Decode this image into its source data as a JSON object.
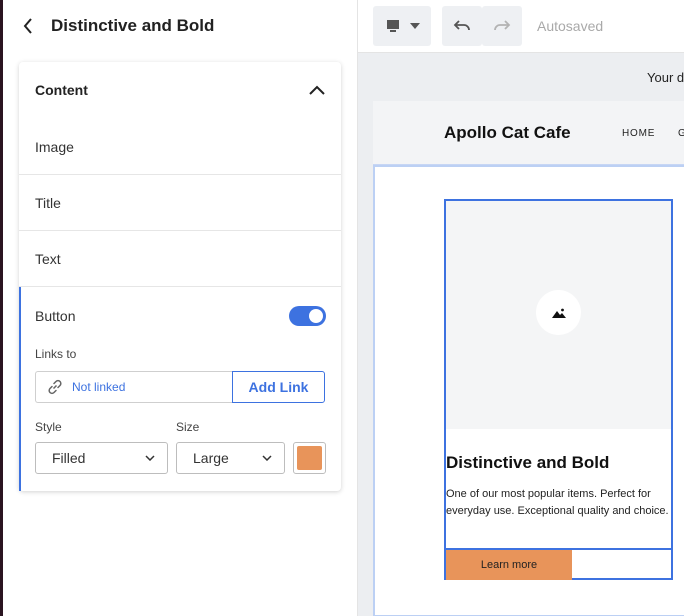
{
  "panel": {
    "title": "Distinctive and Bold",
    "section_label": "Content",
    "rows": [
      {
        "label": "Image"
      },
      {
        "label": "Title"
      },
      {
        "label": "Text"
      }
    ],
    "button": {
      "label": "Button",
      "enabled": true,
      "links_to_label": "Links to",
      "link_value": "Not linked",
      "add_link_label": "Add Link",
      "style_label": "Style",
      "style_value": "Filled",
      "size_label": "Size",
      "size_value": "Large",
      "color": "#e8945a"
    }
  },
  "toolbar": {
    "device_icon": "desktop-icon",
    "autosaved_text": "Autosaved"
  },
  "preview": {
    "domain_text": "Your d",
    "brand": "Apollo Cat Cafe",
    "nav_items": [
      "HOME",
      "G"
    ],
    "item": {
      "title": "Distinctive and Bold",
      "text": "One of our most popular items. Perfect for everyday use. Exceptional quality and choice.",
      "button_label": "Learn more"
    }
  },
  "colors": {
    "accent": "#3d72e0",
    "button_fill": "#e8945a"
  }
}
